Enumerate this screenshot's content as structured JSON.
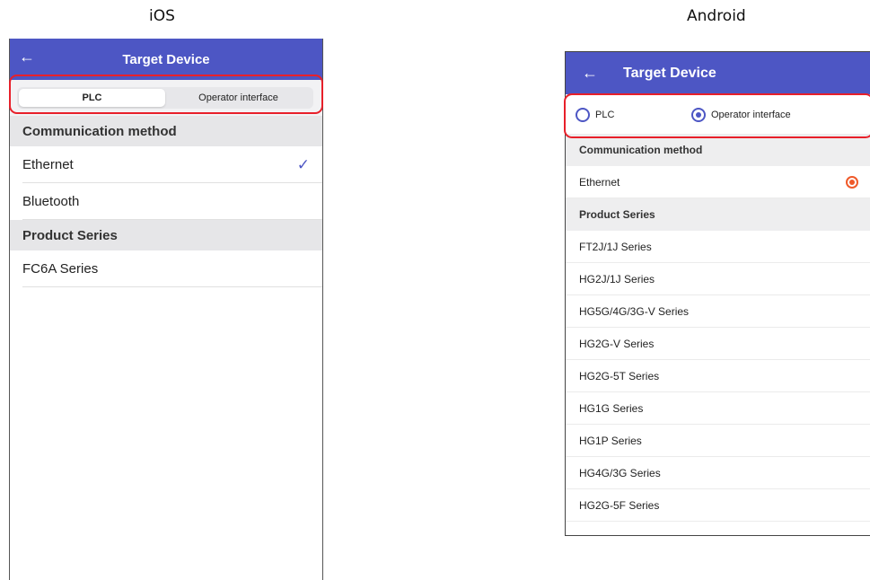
{
  "labels": {
    "ios": "iOS",
    "android": "Android"
  },
  "colors": {
    "header": "#4d56c4",
    "highlight": "#e8202a",
    "android_selected": "#ef5a2a"
  },
  "ios": {
    "header": {
      "back_icon": "arrow-left-icon",
      "back": "←",
      "title": "Target Device"
    },
    "segments": [
      {
        "label": "PLC",
        "selected": true
      },
      {
        "label": "Operator interface",
        "selected": false
      }
    ],
    "sections": {
      "communication_method": "Communication method",
      "product_series": "Product Series"
    },
    "methods": [
      {
        "label": "Ethernet",
        "checked": true
      },
      {
        "label": "Bluetooth",
        "checked": false
      }
    ],
    "check_icon": "✓",
    "series": [
      {
        "label": "FC6A Series"
      }
    ]
  },
  "android": {
    "header": {
      "back_icon": "arrow-left-icon",
      "back": "←",
      "title": "Target Device"
    },
    "radios": [
      {
        "label": "PLC",
        "selected": false
      },
      {
        "label": "Operator interface",
        "selected": true
      }
    ],
    "sections": {
      "communication_method": "Communication method",
      "product_series": "Product Series"
    },
    "methods": [
      {
        "label": "Ethernet",
        "selected": true
      }
    ],
    "series": [
      "FT2J/1J Series",
      "HG2J/1J Series",
      "HG5G/4G/3G-V Series",
      "HG2G-V Series",
      "HG2G-5T Series",
      "HG1G Series",
      "HG1P Series",
      "HG4G/3G Series",
      "HG2G-5F Series"
    ]
  }
}
